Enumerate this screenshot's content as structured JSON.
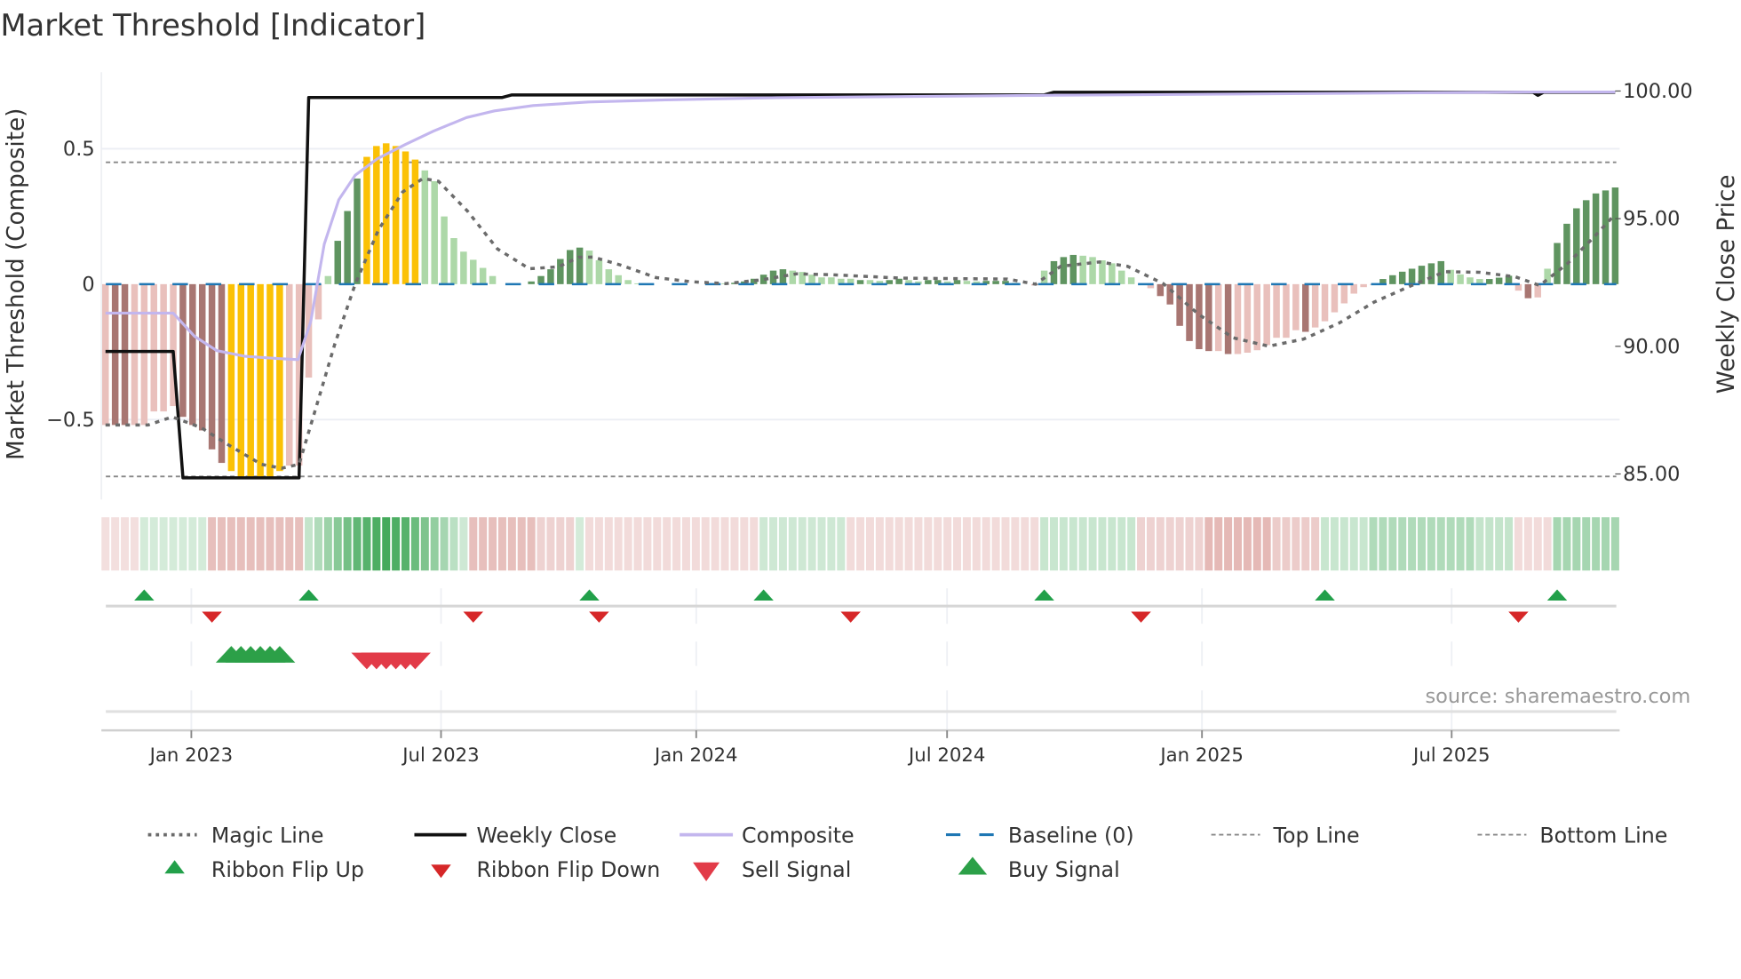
{
  "title": "Market Threshold [Indicator]",
  "source": "source: sharemaestro.com",
  "chart_data": {
    "type": "bar",
    "title": "Market Threshold [Indicator]",
    "xlabel": "",
    "ylabel": "Market Threshold (Composite)",
    "y2label": "Weekly Close Price",
    "ylim": [
      -0.795,
      0.78
    ],
    "y2lim": [
      84.0,
      100.74
    ],
    "y_ticks": [
      {
        "v": 0.5,
        "label": "0.5"
      },
      {
        "v": 0,
        "label": "0"
      },
      {
        "v": -0.5,
        "label": "−0.5"
      }
    ],
    "y2_ticks": [
      {
        "v": 100,
        "label": "100.00"
      },
      {
        "v": 95,
        "label": "95.00"
      },
      {
        "v": 90,
        "label": "90.00"
      },
      {
        "v": 85,
        "label": "85.00"
      }
    ],
    "x_unit": "week index",
    "x_ticks": [
      {
        "x": 8.87,
        "label": "Jan 2023"
      },
      {
        "x": 34.67,
        "label": "Jul 2023"
      },
      {
        "x": 61.04,
        "label": "Jan 2024"
      },
      {
        "x": 86.96,
        "label": "Jul 2024"
      },
      {
        "x": 113.3,
        "label": "Jan 2025"
      },
      {
        "x": 139.1,
        "label": "Jul 2025"
      }
    ],
    "grid": true,
    "top_line": 0.45,
    "bottom_line": -0.71,
    "baseline": 0,
    "composite_bars": [
      -0.52,
      -0.52,
      -0.52,
      -0.52,
      -0.52,
      -0.47,
      -0.47,
      -0.45,
      -0.49,
      -0.52,
      -0.54,
      -0.61,
      -0.66,
      -0.69,
      -0.71,
      -0.71,
      -0.71,
      -0.71,
      -0.69,
      -0.67,
      -0.67,
      -0.345,
      -0.13,
      0.03,
      0.16,
      0.27,
      0.39,
      0.47,
      0.51,
      0.52,
      0.51,
      0.49,
      0.46,
      0.42,
      0.38,
      0.25,
      0.17,
      0.12,
      0.09,
      0.06,
      0.03,
      0,
      0,
      0,
      0.01,
      0.03,
      0.055,
      0.093,
      0.126,
      0.135,
      0.124,
      0.088,
      0.055,
      0.033,
      0.015,
      0.003,
      0,
      0,
      0,
      0,
      0,
      0,
      0,
      0,
      0.003,
      0.005,
      0.01,
      0.02,
      0.035,
      0.05,
      0.055,
      0.05,
      0.045,
      0.035,
      0.025,
      0.025,
      0.02,
      0.02,
      0.015,
      0.015,
      0.012,
      0.015,
      0.02,
      0.015,
      0.01,
      0.015,
      0.015,
      0.01,
      0.015,
      0.012,
      0.01,
      0.012,
      0.012,
      0.012,
      0.005,
      0,
      -0.005,
      0.05,
      0.085,
      0.1,
      0.108,
      0.105,
      0.1,
      0.088,
      0.077,
      0.05,
      0.025,
      0,
      -0.015,
      -0.044,
      -0.075,
      -0.154,
      -0.21,
      -0.24,
      -0.247,
      -0.247,
      -0.258,
      -0.258,
      -0.253,
      -0.244,
      -0.225,
      -0.198,
      -0.198,
      -0.17,
      -0.176,
      -0.16,
      -0.137,
      -0.104,
      -0.071,
      -0.035,
      -0.011,
      -0.003,
      0.019,
      0.033,
      0.046,
      0.057,
      0.068,
      0.077,
      0.085,
      0.053,
      0.036,
      0.025,
      0.019,
      0.019,
      0.024,
      0.031,
      -0.024,
      -0.052,
      -0.049,
      0.057,
      0.152,
      0.223,
      0.28,
      0.31,
      0.335,
      0.346,
      0.357
    ],
    "bar_states": "LDDLLLLLDDDDDYYYYYYLLLLgGGGYYYYYYgggggggggggGGGGGGgggggggggggggggGGGGGGgggggggGggGGggGGgGggGGGggLgGGGgggggggLDDDDDDLDLLLLLLLDLLLLLLLGGGGGGGggggGGGLDLgGGGGGGG",
    "bar_state_colors": {
      "L": "#e9c0bc",
      "D": "#a87672",
      "g": "#add8a8",
      "G": "#5f9460",
      "Y": "#fbc105"
    },
    "magic_line": [
      [
        0,
        -0.52
      ],
      [
        4.4,
        -0.52
      ],
      [
        6.9,
        -0.49
      ],
      [
        9.9,
        -0.53
      ],
      [
        13,
        -0.6
      ],
      [
        16.1,
        -0.665
      ],
      [
        18.2,
        -0.68
      ],
      [
        20,
        -0.665
      ],
      [
        21.8,
        -0.45
      ],
      [
        23.7,
        -0.22
      ],
      [
        25.8,
        0
      ],
      [
        28.2,
        0.2
      ],
      [
        30.7,
        0.34
      ],
      [
        32.8,
        0.39
      ],
      [
        34.4,
        0.38
      ],
      [
        37.4,
        0.27
      ],
      [
        40.5,
        0.13
      ],
      [
        43.8,
        0.057
      ],
      [
        46.8,
        0.064
      ],
      [
        48.9,
        0.099
      ],
      [
        50.4,
        0.1
      ],
      [
        53.2,
        0.071
      ],
      [
        56.9,
        0.024
      ],
      [
        60.5,
        0.009
      ],
      [
        64.1,
        0.002
      ],
      [
        67.8,
        0.016
      ],
      [
        71.4,
        0.038
      ],
      [
        75,
        0.035
      ],
      [
        82.3,
        0.022
      ],
      [
        93.2,
        0.019
      ],
      [
        96.1,
        0
      ],
      [
        98.7,
        0.066
      ],
      [
        102.7,
        0.082
      ],
      [
        105.6,
        0.066
      ],
      [
        109.3,
        0.002
      ],
      [
        112.9,
        -0.11
      ],
      [
        116.5,
        -0.198
      ],
      [
        120.2,
        -0.229
      ],
      [
        123.8,
        -0.203
      ],
      [
        127.5,
        -0.143
      ],
      [
        131.1,
        -0.066
      ],
      [
        134.7,
        -0.009
      ],
      [
        138.4,
        0.046
      ],
      [
        142,
        0.044
      ],
      [
        145.7,
        0.027
      ],
      [
        148.2,
        -0.005
      ],
      [
        151.1,
        0.077
      ],
      [
        153.7,
        0.17
      ],
      [
        156,
        0.258
      ]
    ],
    "weekly_close": [
      [
        0,
        89.8
      ],
      [
        7,
        89.8
      ],
      [
        8,
        84.85
      ],
      [
        20,
        84.85
      ],
      [
        21,
        99.75
      ],
      [
        41,
        99.75
      ],
      [
        42,
        99.85
      ],
      [
        97,
        99.85
      ],
      [
        98,
        99.95
      ],
      [
        147.5,
        99.95
      ],
      [
        148,
        99.83
      ],
      [
        148.6,
        99.95
      ],
      [
        156,
        99.95
      ]
    ],
    "composite_line": [
      [
        0,
        91.3
      ],
      [
        7,
        91.3
      ],
      [
        9.2,
        90.39
      ],
      [
        11.5,
        89.83
      ],
      [
        14.4,
        89.61
      ],
      [
        17.8,
        89.52
      ],
      [
        19.9,
        89.48
      ],
      [
        21.2,
        90.96
      ],
      [
        22.6,
        94.0
      ],
      [
        24.1,
        95.74
      ],
      [
        25.8,
        96.7
      ],
      [
        28.1,
        97.35
      ],
      [
        31,
        97.91
      ],
      [
        33.9,
        98.43
      ],
      [
        37.3,
        98.96
      ],
      [
        40.2,
        99.22
      ],
      [
        44.2,
        99.43
      ],
      [
        49.9,
        99.57
      ],
      [
        57.9,
        99.65
      ],
      [
        69.4,
        99.74
      ],
      [
        96.4,
        99.83
      ],
      [
        147.4,
        99.96
      ],
      [
        156,
        99.96
      ]
    ],
    "ribbon": [
      {
        "from": 0,
        "to": 3,
        "v": -0.25
      },
      {
        "from": 4,
        "to": 10,
        "v": 0.22
      },
      {
        "from": 11,
        "to": 20,
        "v": -0.5
      },
      {
        "from": 21,
        "to": 21,
        "v": 0.3
      },
      {
        "from": 22,
        "to": 22,
        "v": 0.4
      },
      {
        "from": 23,
        "to": 23,
        "v": 0.5
      },
      {
        "from": 24,
        "to": 24,
        "v": 0.6
      },
      {
        "from": 25,
        "to": 25,
        "v": 0.7
      },
      {
        "from": 26,
        "to": 26,
        "v": 0.8
      },
      {
        "from": 27,
        "to": 27,
        "v": 0.85
      },
      {
        "from": 28,
        "to": 28,
        "v": 0.9
      },
      {
        "from": 29,
        "to": 29,
        "v": 0.95
      },
      {
        "from": 30,
        "to": 30,
        "v": 0.9
      },
      {
        "from": 31,
        "to": 31,
        "v": 0.85
      },
      {
        "from": 32,
        "to": 32,
        "v": 0.75
      },
      {
        "from": 33,
        "to": 33,
        "v": 0.65
      },
      {
        "from": 34,
        "to": 34,
        "v": 0.55
      },
      {
        "from": 35,
        "to": 35,
        "v": 0.45
      },
      {
        "from": 36,
        "to": 36,
        "v": 0.35
      },
      {
        "from": 37,
        "to": 37,
        "v": 0.25
      },
      {
        "from": 38,
        "to": 44,
        "v": -0.5
      },
      {
        "from": 45,
        "to": 48,
        "v": -0.35
      },
      {
        "from": 49,
        "to": 49,
        "v": 0.22
      },
      {
        "from": 50,
        "to": 67,
        "v": -0.28
      },
      {
        "from": 68,
        "to": 76,
        "v": 0.25
      },
      {
        "from": 77,
        "to": 96,
        "v": -0.28
      },
      {
        "from": 97,
        "to": 106,
        "v": 0.28
      },
      {
        "from": 107,
        "to": 113,
        "v": -0.35
      },
      {
        "from": 114,
        "to": 120,
        "v": -0.55
      },
      {
        "from": 121,
        "to": 125,
        "v": -0.4
      },
      {
        "from": 126,
        "to": 130,
        "v": 0.28
      },
      {
        "from": 131,
        "to": 141,
        "v": 0.4
      },
      {
        "from": 142,
        "to": 145,
        "v": 0.3
      },
      {
        "from": 146,
        "to": 149,
        "v": -0.28
      },
      {
        "from": 150,
        "to": 156,
        "v": 0.45
      }
    ],
    "ribbon_flip_up": [
      4,
      21,
      50,
      68,
      97,
      126,
      150
    ],
    "ribbon_flip_down": [
      11,
      38,
      51,
      77,
      107,
      146
    ],
    "buy_signals": [
      13,
      14,
      15,
      16,
      17,
      18
    ],
    "sell_signals": [
      27,
      28,
      29,
      30,
      31,
      32
    ],
    "colors": {
      "magic": "#6b6b6b",
      "close": "#111111",
      "composite": "#c3b6ee",
      "baseline": "#1f77b4",
      "threshold": "#888888",
      "flip_up": "#22a04a",
      "flip_down": "#d62728",
      "buy": "#2ca048",
      "sell": "#e23b48"
    },
    "legend": {
      "placement": "bottom",
      "items": [
        {
          "label": "Magic Line"
        },
        {
          "label": "Weekly Close"
        },
        {
          "label": "Composite"
        },
        {
          "label": "Baseline (0)"
        },
        {
          "label": "Top Line"
        },
        {
          "label": "Bottom Line"
        },
        {
          "label": "Ribbon Flip Up"
        },
        {
          "label": "Ribbon Flip Down"
        },
        {
          "label": "Sell Signal"
        },
        {
          "label": "Buy Signal"
        }
      ]
    }
  }
}
